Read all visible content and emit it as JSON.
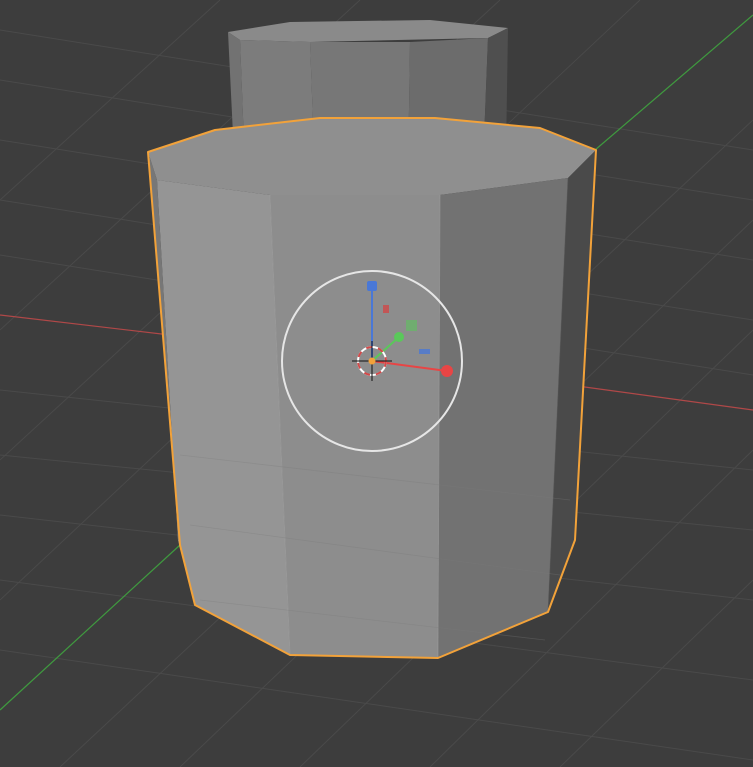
{
  "viewport": {
    "background": "#3d3d3d",
    "grid_color": "#4a4a4a",
    "x_axis_color": "#b04848",
    "y_axis_color": "#3f9a3f",
    "selection_outline_color": "#f2a23a"
  },
  "scene": {
    "active_object": "octagonal-prism",
    "object_shading": "solid",
    "object_selected": true
  },
  "gizmo": {
    "type": "transform",
    "axes": {
      "x": {
        "color": "#e84545",
        "label": ""
      },
      "y": {
        "color": "#5ac85a",
        "label": ""
      },
      "z": {
        "color": "#4a78d6",
        "label": ""
      }
    },
    "rotation_ring_color": "#e6e6e6",
    "cursor": "3d-cursor"
  }
}
